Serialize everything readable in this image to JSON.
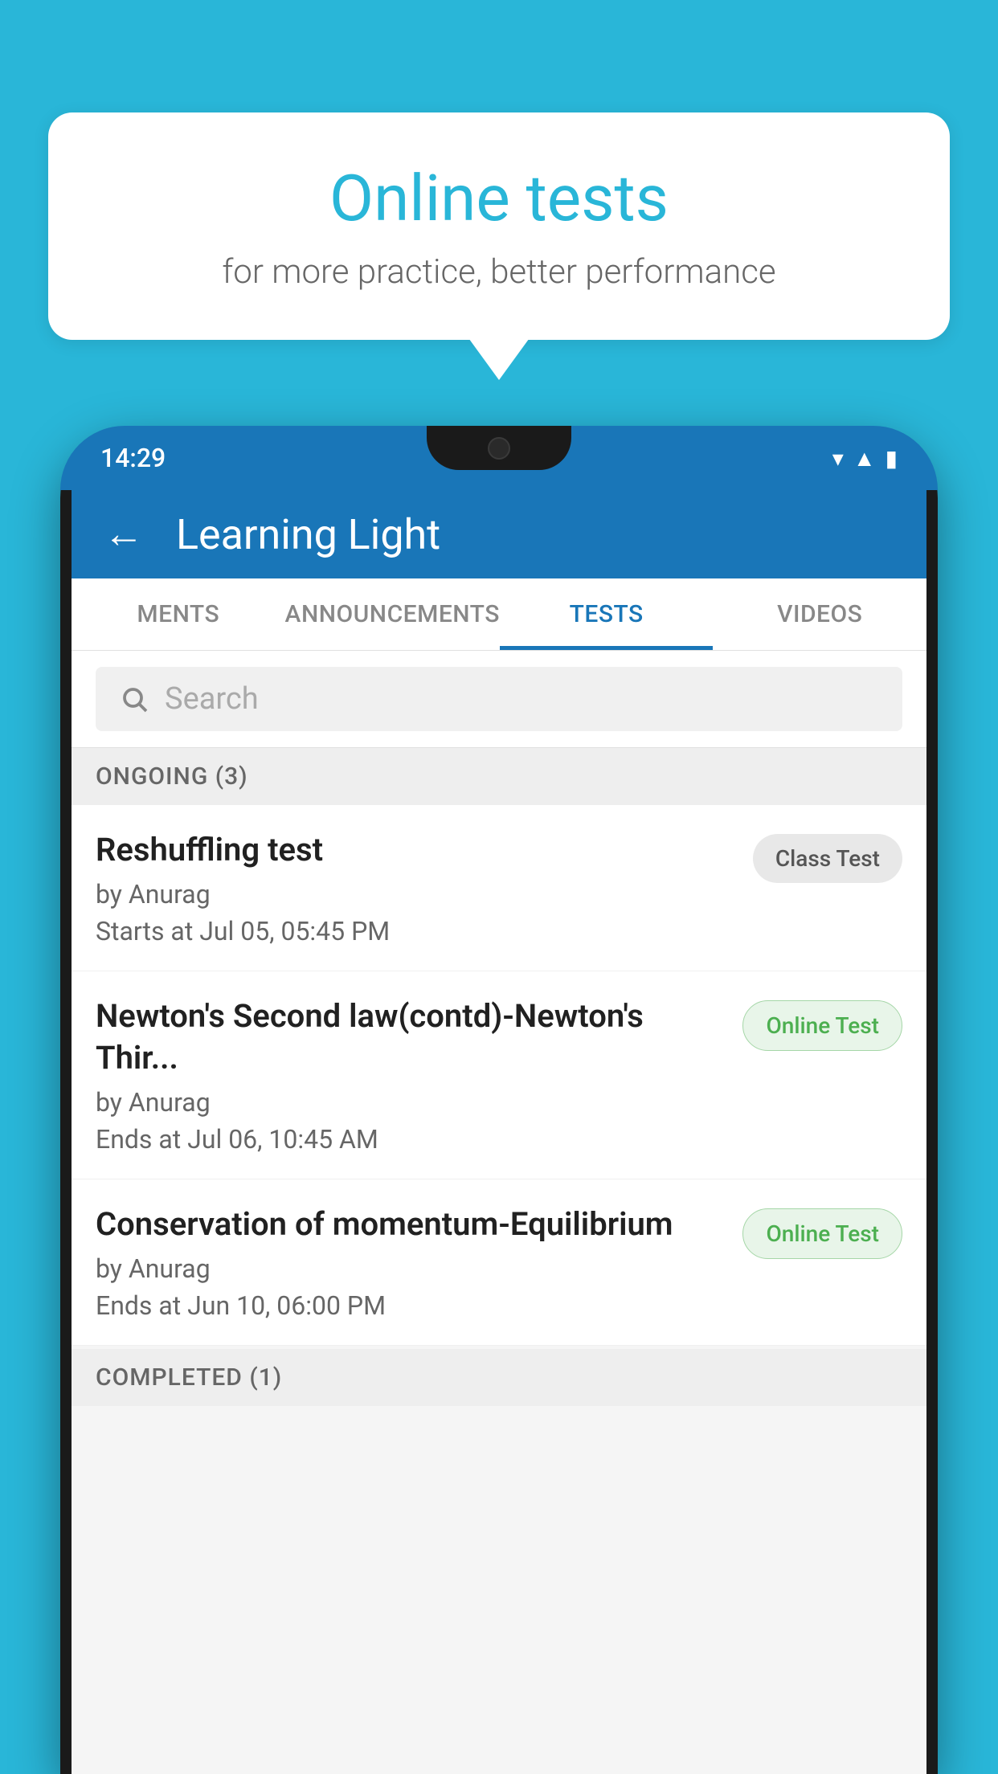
{
  "background_color": "#29b6d8",
  "speech_bubble": {
    "title": "Online tests",
    "subtitle": "for more practice, better performance"
  },
  "phone": {
    "status_bar": {
      "time": "14:29",
      "icons": [
        "wifi",
        "signal",
        "battery"
      ]
    },
    "header": {
      "title": "Learning Light",
      "back_label": "←"
    },
    "tabs": [
      {
        "label": "MENTS",
        "active": false
      },
      {
        "label": "ANNOUNCEMENTS",
        "active": false
      },
      {
        "label": "TESTS",
        "active": true
      },
      {
        "label": "VIDEOS",
        "active": false
      }
    ],
    "search": {
      "placeholder": "Search"
    },
    "ongoing_section": {
      "title": "ONGOING (3)",
      "tests": [
        {
          "name": "Reshuffling test",
          "author": "by Anurag",
          "time_label": "Starts at",
          "time_value": "Jul 05, 05:45 PM",
          "badge": "Class Test",
          "badge_type": "class"
        },
        {
          "name": "Newton's Second law(contd)-Newton's Thir...",
          "author": "by Anurag",
          "time_label": "Ends at",
          "time_value": "Jul 06, 10:45 AM",
          "badge": "Online Test",
          "badge_type": "online"
        },
        {
          "name": "Conservation of momentum-Equilibrium",
          "author": "by Anurag",
          "time_label": "Ends at",
          "time_value": "Jun 10, 06:00 PM",
          "badge": "Online Test",
          "badge_type": "online"
        }
      ]
    },
    "completed_section": {
      "title": "COMPLETED (1)"
    }
  }
}
